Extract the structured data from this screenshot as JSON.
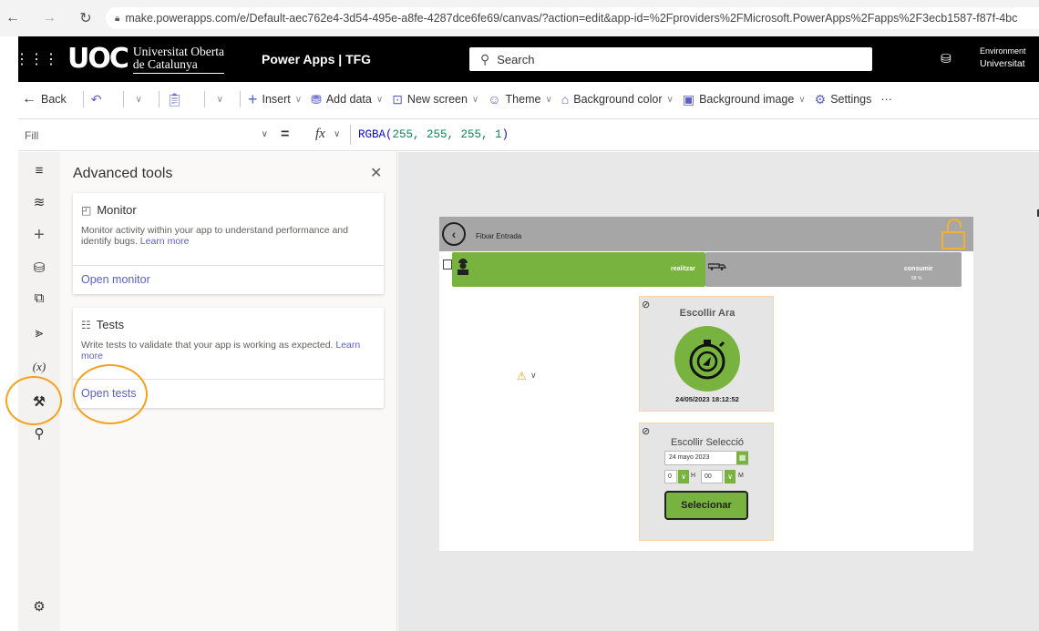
{
  "browser": {
    "url": "make.powerapps.com/e/Default-aec762e4-3d54-495e-a8fe-4287dce6fe69/canvas/?action=edit&app-id=%2Fproviders%2FMicrosoft.PowerApps%2Fapps%2F3ecb1587-f87f-4bc"
  },
  "header": {
    "logo_mark": "UOC",
    "logo_line1": "Universitat Oberta",
    "logo_line2": "de Catalunya",
    "app_name": "Power Apps | TFG",
    "search_placeholder": "Search",
    "env_line1": "Environment",
    "env_line2": "Universitat"
  },
  "command_bar": {
    "back": "Back",
    "insert": "Insert",
    "add_data": "Add data",
    "new_screen": "New screen",
    "theme": "Theme",
    "background_color": "Background color",
    "background_image": "Background image",
    "settings": "Settings",
    "more": "···"
  },
  "formula_bar": {
    "property": "Fill",
    "equals": "=",
    "fx": "fx",
    "formula_fn": "RGBA(",
    "formula_args": "255, 255, 255, 1",
    "formula_close": ")"
  },
  "panel": {
    "title": "Advanced tools",
    "monitor": {
      "title": "Monitor",
      "description": "Monitor activity within your app to understand performance and identify bugs.",
      "learn_more": "Learn more",
      "action": "Open monitor"
    },
    "tests": {
      "title": "Tests",
      "description": "Write tests to validate that your app is working as expected.",
      "learn_more": "Learn more",
      "action": "Open tests"
    }
  },
  "app_screen": {
    "title": "Fitxar Entrada",
    "tab_left": "realitzar",
    "tab_right": "consumir",
    "tab_right_sub": "58 %",
    "card_now_title": "Escollir Ara",
    "card_now_timestamp": "24/05/2023 18:12:52",
    "card_select_title": "Escollir Selecció",
    "date_value": "24 mayo 2023",
    "hour_value": "0",
    "hour_label": "H",
    "minute_value": "00",
    "minute_label": "M",
    "select_button": "Selecionar"
  },
  "colors": {
    "accent_green": "#79b33f",
    "annotation_orange": "#f7a21b",
    "link_purple": "#5b5fc7"
  }
}
